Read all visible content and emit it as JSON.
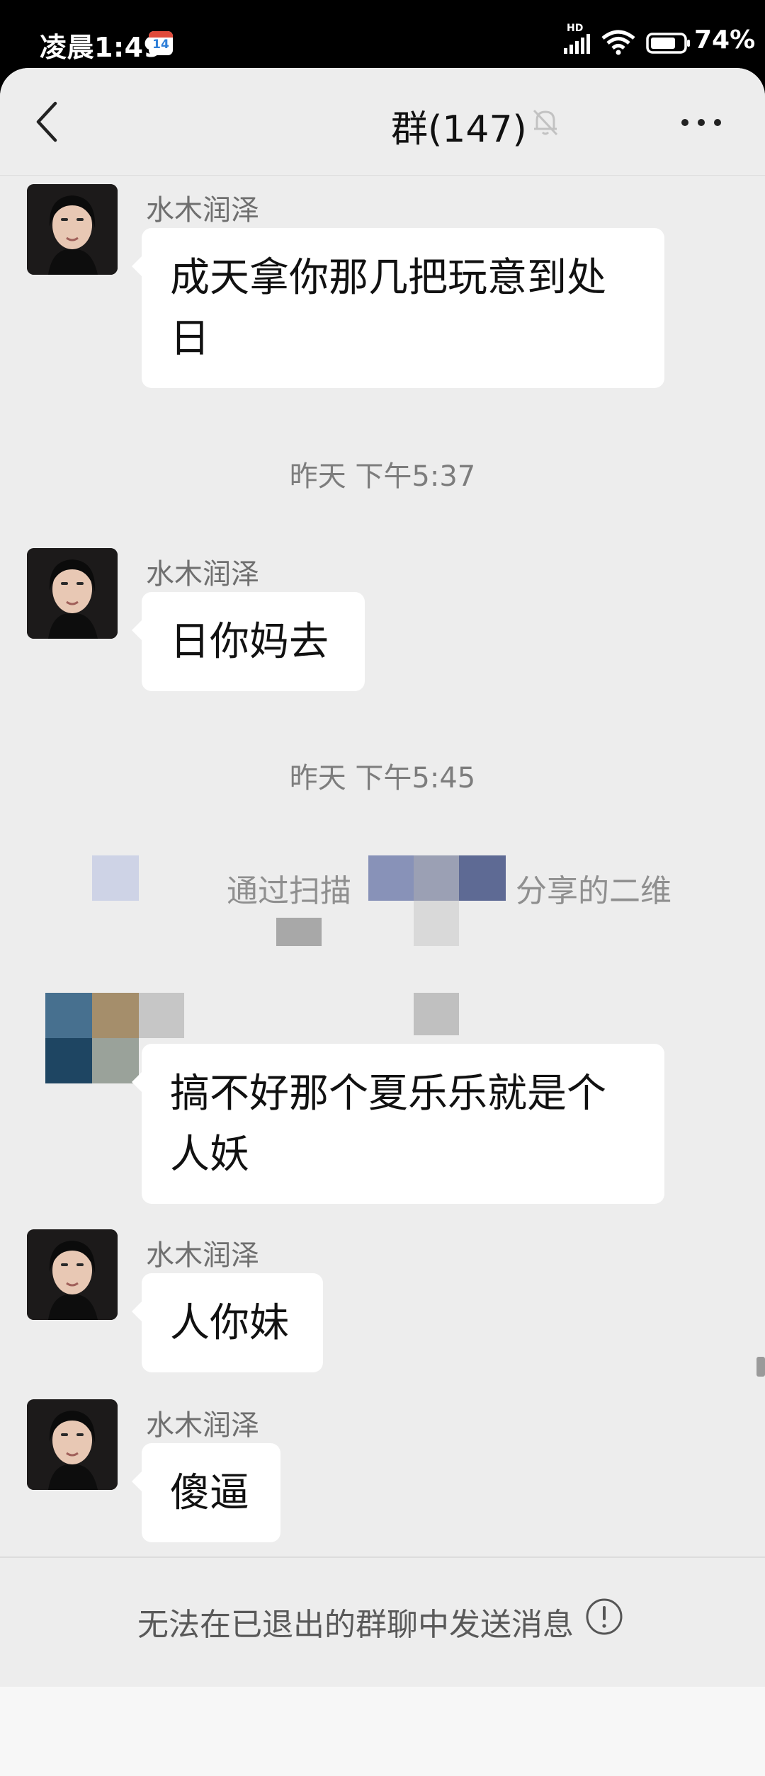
{
  "status_bar": {
    "time": "凌晨1:49",
    "calendar_badge": "14",
    "network_label": "HD",
    "battery_percent": "74%"
  },
  "header": {
    "title": "群(147)",
    "back_icon": "chevron-left-icon",
    "mute_icon": "bell-off-icon",
    "more_icon": "more-dots-icon"
  },
  "messages": [
    {
      "type": "message",
      "sender": "水木润泽",
      "lines": [
        "成天拿你那几把玩意到处",
        "日"
      ]
    },
    {
      "type": "timestamp",
      "text": "昨天 下午5:37"
    },
    {
      "type": "message",
      "sender": "水木润泽",
      "lines": [
        "日你妈去"
      ]
    },
    {
      "type": "timestamp",
      "text": "昨天 下午5:45"
    },
    {
      "type": "system",
      "text_a": "通过扫描",
      "text_b": "分享的二维"
    },
    {
      "type": "message",
      "sender": "",
      "lines": [
        "搞不好那个夏乐乐就是个",
        "人妖"
      ]
    },
    {
      "type": "message",
      "sender": "水木润泽",
      "lines": [
        "人你妹"
      ]
    },
    {
      "type": "message",
      "sender": "水木润泽",
      "lines": [
        "傻逼"
      ]
    }
  ],
  "footer": {
    "notice": "无法在已退出的群聊中发送消息",
    "notice_icon": "info-icon"
  },
  "colors": {
    "background": "#ededed",
    "bubble": "#ffffff",
    "status_bar": "#000000"
  }
}
